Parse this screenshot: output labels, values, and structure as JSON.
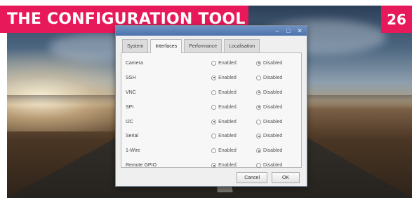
{
  "header": {
    "title": "THE CONFIGURATION TOOL",
    "page_number": "26"
  },
  "window": {
    "controls": [
      "–",
      "□",
      "✕"
    ],
    "tabs": [
      {
        "label": "System",
        "active": false
      },
      {
        "label": "Interfaces",
        "active": true
      },
      {
        "label": "Performance",
        "active": false
      },
      {
        "label": "Localisation",
        "active": false
      }
    ],
    "interfaces": [
      {
        "name": "Camera",
        "enabled_label": "Enabled",
        "disabled_label": "Disabled",
        "selected": "disabled"
      },
      {
        "name": "SSH",
        "enabled_label": "Enabled",
        "disabled_label": "Disabled",
        "selected": "enabled"
      },
      {
        "name": "VNC",
        "enabled_label": "Enabled",
        "disabled_label": "Disabled",
        "selected": "disabled"
      },
      {
        "name": "SPI",
        "enabled_label": "Enabled",
        "disabled_label": "Disabled",
        "selected": "disabled"
      },
      {
        "name": "I2C",
        "enabled_label": "Enabled",
        "disabled_label": "Disabled",
        "selected": "enabled"
      },
      {
        "name": "Serial",
        "enabled_label": "Enabled",
        "disabled_label": "Disabled",
        "selected": "disabled"
      },
      {
        "name": "1-Wire",
        "enabled_label": "Enabled",
        "disabled_label": "Disabled",
        "selected": "disabled"
      },
      {
        "name": "Remote GPIO",
        "enabled_label": "Enabled",
        "disabled_label": "Disabled",
        "selected": "enabled"
      }
    ],
    "buttons": {
      "cancel": "Cancel",
      "ok": "OK"
    }
  },
  "colors": {
    "banner": "#e8195a",
    "titlebar": "#4c72ab",
    "dialog_bg": "#efefef"
  }
}
